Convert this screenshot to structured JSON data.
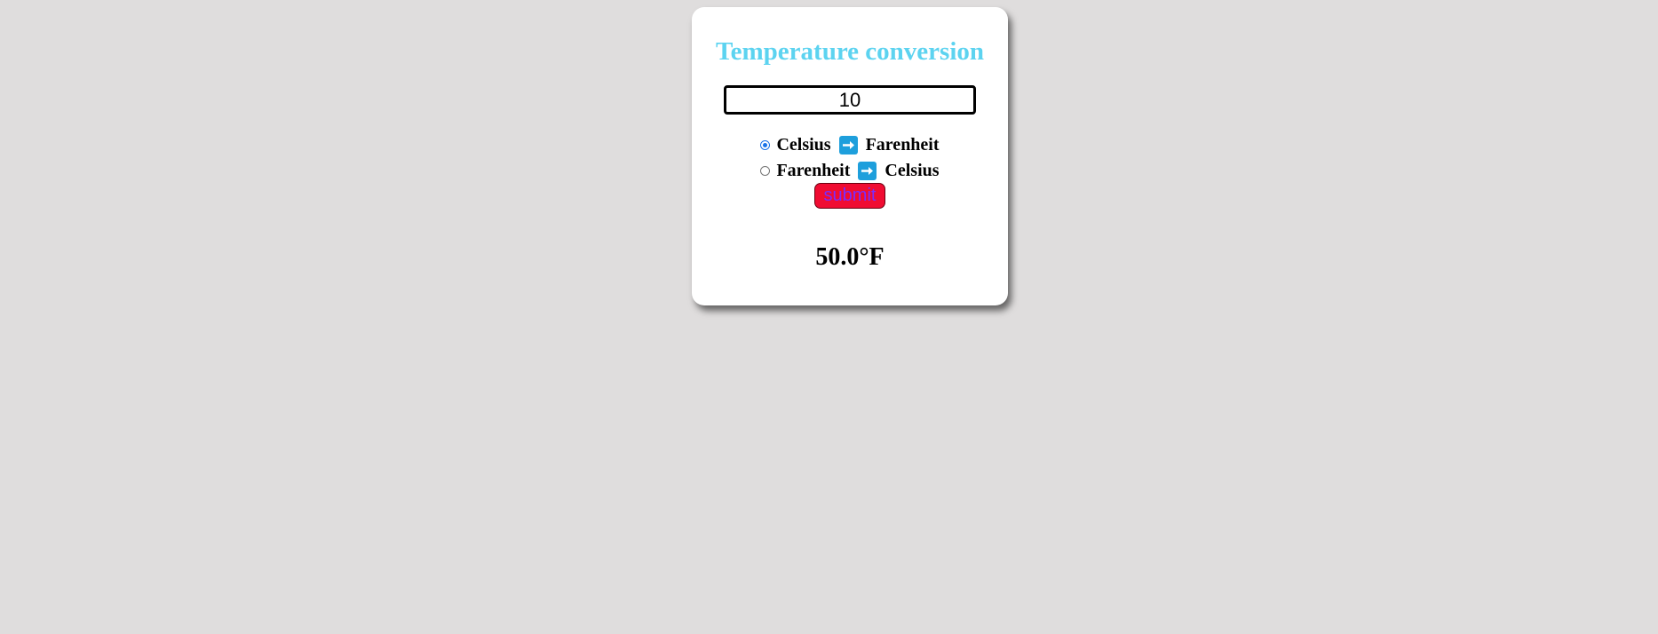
{
  "header": {
    "title": "Temperature conversion"
  },
  "form": {
    "temperature_value": "10",
    "options": [
      {
        "from": "Celsius",
        "to": "Farenheit",
        "selected": true
      },
      {
        "from": "Farenheit",
        "to": "Celsius",
        "selected": false
      }
    ],
    "submit_label": "submit"
  },
  "result": {
    "text": "50.0°F"
  },
  "icons": {
    "arrow": "right-arrow-icon"
  },
  "colors": {
    "background": "#dfdddd",
    "title": "#5cd3f0",
    "submit_bg": "#f00c32",
    "submit_text": "#7a2cff",
    "arrow_bg": "#1e9fdc",
    "radio_selected": "#1a73e8"
  }
}
